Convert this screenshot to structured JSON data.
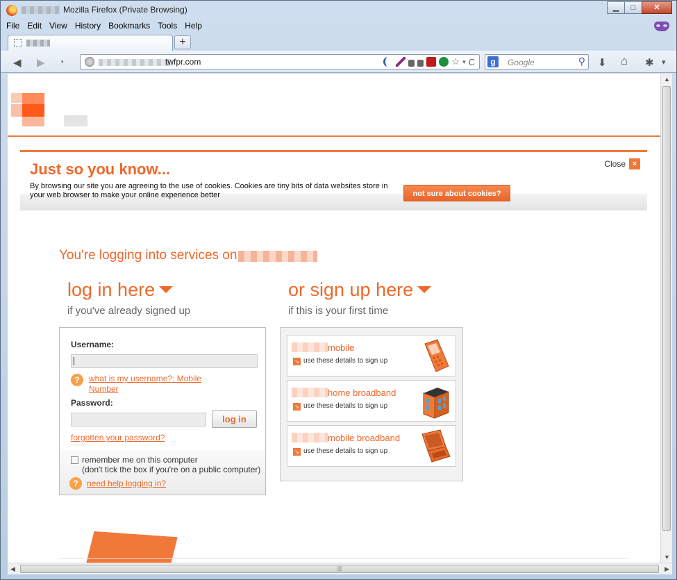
{
  "window": {
    "title": "Mozilla Firefox (Private Browsing)",
    "buttons": {
      "minimize": "▁",
      "maximize": "□",
      "close": "✕"
    }
  },
  "menu": [
    "File",
    "Edit",
    "View",
    "History",
    "Bookmarks",
    "Tools",
    "Help"
  ],
  "tabbar": {
    "new_tab": "+"
  },
  "navbar": {
    "back": "◀",
    "forward": "▶",
    "url_suffix": "twfpr.com",
    "search_engine": "g",
    "search_placeholder": "Google",
    "reload": "C",
    "star": "☆",
    "download": "⬇",
    "home": "⌂",
    "menu_arrow": "▾"
  },
  "cookie_notice": {
    "title": "Just so you know...",
    "close_label": "Close",
    "close_x": "×",
    "body": "By browsing our site you are agreeing to the use of cookies. Cookies are tiny bits of data websites store in your web browser to make your online experience better",
    "button": "not sure about cookies?"
  },
  "page": {
    "services_heading": "You're logging into services on",
    "login": {
      "heading": "log in here",
      "subheading": "if you've already signed up",
      "username_label": "Username:",
      "username_help": "what is my username?: Mobile Number",
      "password_label": "Password:",
      "login_button": "log in",
      "forgot_link": "forgotten your password?",
      "remember_line1": "remember me on this computer",
      "remember_line2": "(don't tick the box if you're on a public computer)",
      "help_link": "need help logging in?",
      "help_icon": "?"
    },
    "signup": {
      "heading": "or sign up here",
      "subheading": "if this is your first time",
      "items": [
        {
          "title": "mobile",
          "text": "use these details to sign up"
        },
        {
          "title": "home broadband",
          "text": "use these details to sign up"
        },
        {
          "title": "mobile broadband",
          "text": "use these details to sign up"
        }
      ],
      "arrow": "↘"
    }
  },
  "colors": {
    "accent": "#f0682a",
    "accent_light": "#f0793a"
  }
}
